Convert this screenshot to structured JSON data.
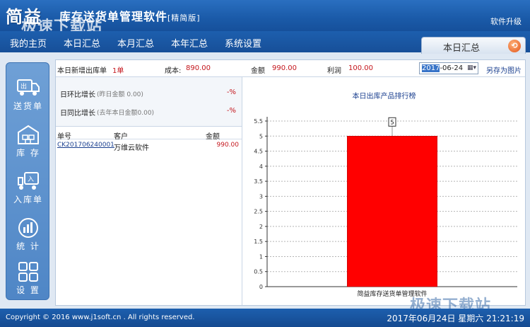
{
  "titlebar": {
    "logo": "简益",
    "title": "库存送货单管理软件",
    "edition": "[精简版]",
    "watermark": "极速下载站",
    "upgrade": "软件升级"
  },
  "menu": {
    "items": [
      {
        "label": "我的主页"
      },
      {
        "label": "本日汇总"
      },
      {
        "label": "本月汇总"
      },
      {
        "label": "本年汇总"
      },
      {
        "label": "系统设置"
      }
    ],
    "active_tab": "本日汇总"
  },
  "sidebar": {
    "items": [
      {
        "label": "送货单",
        "icon": "delivery-icon"
      },
      {
        "label": "库 存",
        "icon": "inventory-icon"
      },
      {
        "label": "入库单",
        "icon": "inbound-icon"
      },
      {
        "label": "统 计",
        "icon": "statistics-icon"
      },
      {
        "label": "设 置",
        "icon": "settings-icon"
      }
    ]
  },
  "summary": {
    "new_out_label": "本日新增出库单",
    "new_out_value": "1单",
    "cost_label": "成本:",
    "cost_value": "890.00",
    "amount_label": "金额",
    "amount_value": "990.00",
    "profit_label": "利润",
    "profit_value": "100.00",
    "date_year": "2017",
    "date_rest": "-06-24",
    "save_image": "另存为图片"
  },
  "ratios": {
    "mom_label": "日环比增长",
    "mom_sub": "(昨日金额 0.00)",
    "mom_value": "-%",
    "yoy_label": "日同比增长",
    "yoy_sub": "(去年本日金额0.00)",
    "yoy_value": "-%"
  },
  "table": {
    "headers": [
      "单号",
      "客户",
      "金额"
    ],
    "rows": [
      {
        "no": "CK201706240001",
        "customer": "万维云软件",
        "amount": "990.00"
      }
    ]
  },
  "chart_data": {
    "type": "bar",
    "title": "本日出库产品排行榜",
    "categories": [
      "简益库存送货单管理软件"
    ],
    "values": [
      5
    ],
    "data_labels": [
      "5"
    ],
    "ylim": [
      0,
      5.5
    ],
    "yticks": [
      "0",
      "0.5",
      "1",
      "1.5",
      "2",
      "2.5",
      "3",
      "3.5",
      "4",
      "4.5",
      "5",
      "5.5"
    ],
    "grid": true,
    "bar_color": "#ff0000"
  },
  "status": {
    "copyright": "Copyright © 2016 www.j1soft.cn . All rights reserved.",
    "clock": "2017年06月24日 星期六 21:21:19",
    "watermark": "极速下载站"
  }
}
